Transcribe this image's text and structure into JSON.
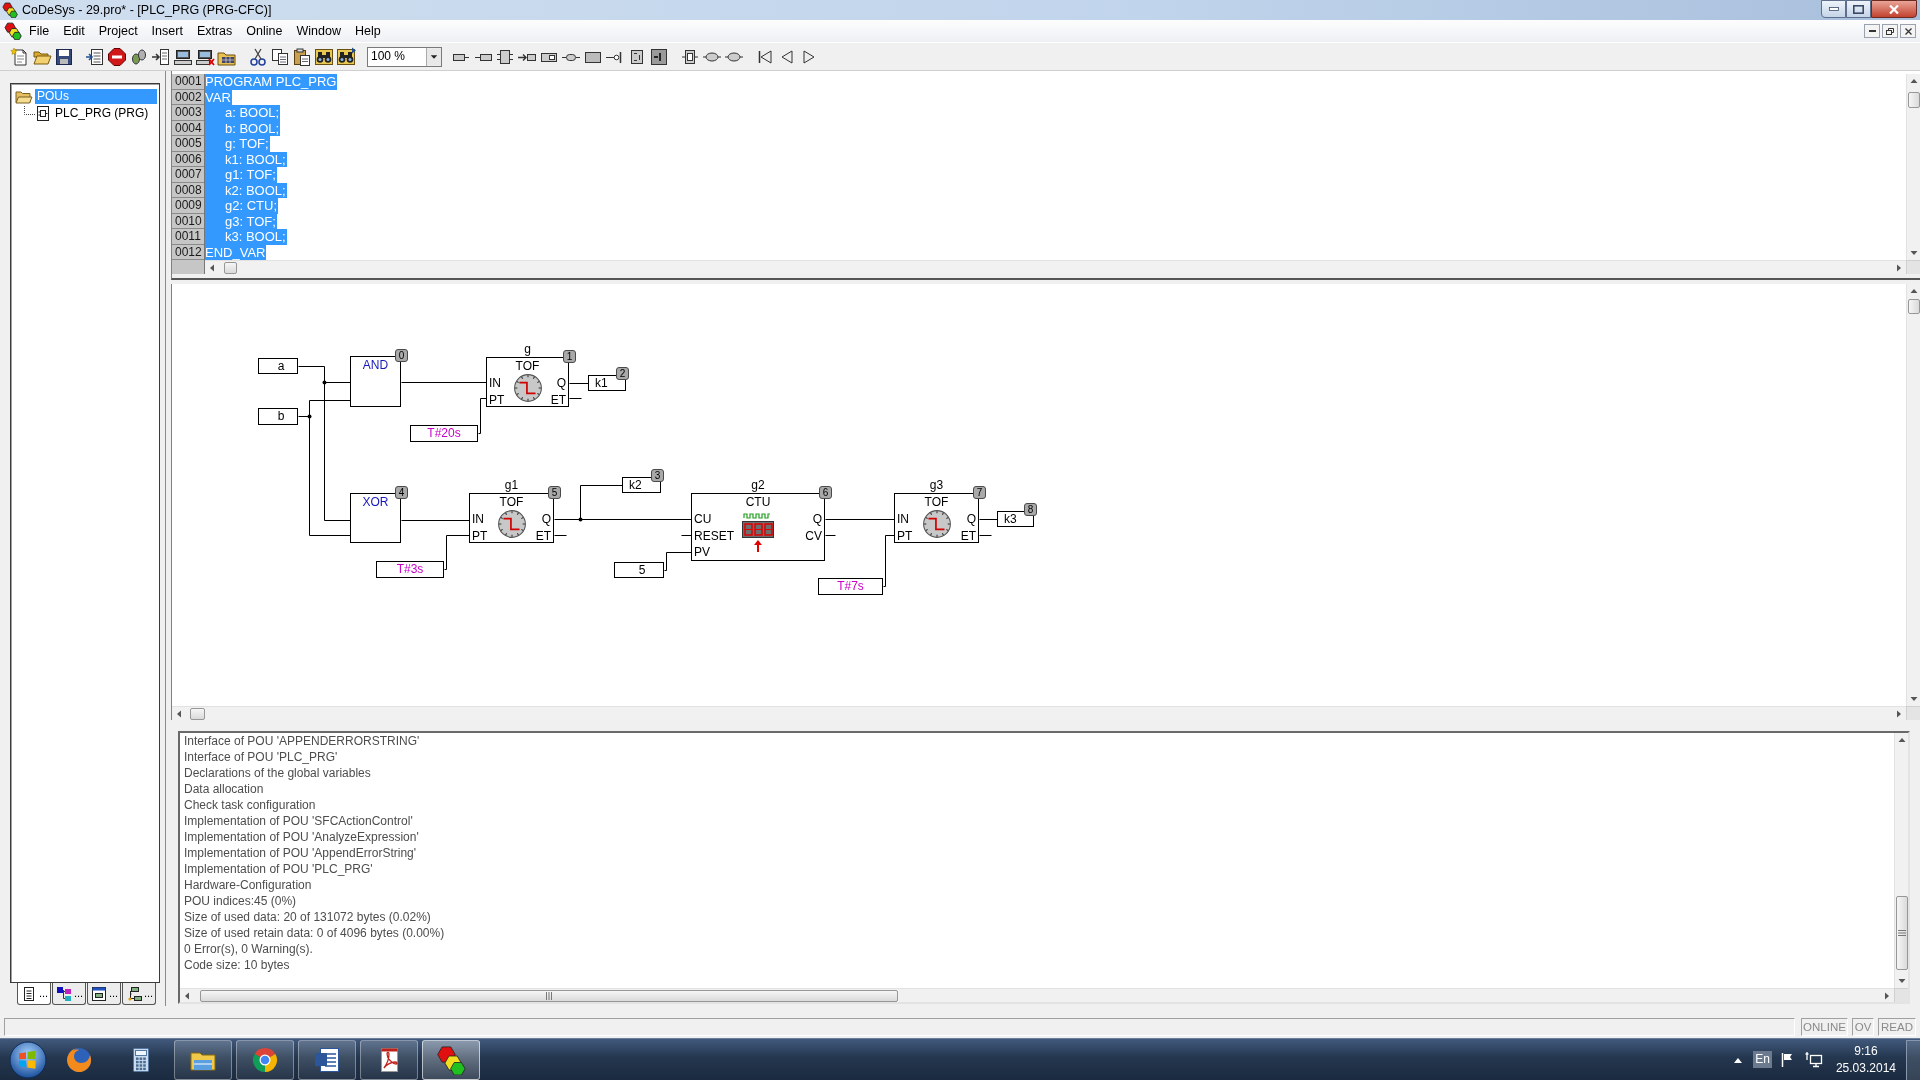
{
  "window": {
    "title": "CoDeSys - 29.pro* - [PLC_PRG (PRG-CFC)]"
  },
  "menu": [
    "File",
    "Edit",
    "Project",
    "Insert",
    "Extras",
    "Online",
    "Window",
    "Help"
  ],
  "toolbar": {
    "zoom": "100 %"
  },
  "project_panel": {
    "tree": [
      {
        "label": "POUs",
        "selected": true,
        "children": [
          {
            "label": "PLC_PRG (PRG)",
            "selected": false
          }
        ]
      }
    ],
    "tabs": [
      {
        "label": "...",
        "selected": true
      },
      {
        "label": "...",
        "selected": false
      },
      {
        "label": "...",
        "selected": false
      },
      {
        "label": "...",
        "selected": false
      }
    ]
  },
  "declaration": {
    "lines": [
      {
        "number": "0001",
        "text": "PROGRAM PLC_PRG",
        "selected": true
      },
      {
        "number": "0002",
        "text": "VAR",
        "selected": true
      },
      {
        "number": "0003",
        "text": "\ta: BOOL;",
        "selected": true
      },
      {
        "number": "0004",
        "text": "\tb: BOOL;",
        "selected": true
      },
      {
        "number": "0005",
        "text": "\tg: TOF;",
        "selected": true
      },
      {
        "number": "0006",
        "text": "\tk1: BOOL;",
        "selected": true
      },
      {
        "number": "0007",
        "text": "\tg1: TOF;",
        "selected": true
      },
      {
        "number": "0008",
        "text": "\tk2: BOOL;",
        "selected": true
      },
      {
        "number": "0009",
        "text": "\tg2: CTU;",
        "selected": true
      },
      {
        "number": "0010",
        "text": "\tg3: TOF;",
        "selected": true
      },
      {
        "number": "0011",
        "text": "\tk3: BOOL;",
        "selected": true
      },
      {
        "number": "0012",
        "text": "END_VAR",
        "selected": true
      }
    ]
  },
  "cfc_diagram": {
    "elements": [
      {
        "kind": "input",
        "text": "a"
      },
      {
        "kind": "operator",
        "type": "AND",
        "order": "0"
      },
      {
        "kind": "timer",
        "instance": "g",
        "type": "TOF",
        "order": "1",
        "inputs": [
          "IN",
          "PT"
        ],
        "outputs": [
          "Q",
          "ET"
        ]
      },
      {
        "kind": "output",
        "text": "k1",
        "order": "2"
      },
      {
        "kind": "input",
        "text": "b"
      },
      {
        "kind": "time_literal",
        "text": "T#20s"
      },
      {
        "kind": "output",
        "text": "k2",
        "order": "3"
      },
      {
        "kind": "operator",
        "type": "XOR",
        "order": "4"
      },
      {
        "kind": "timer",
        "instance": "g1",
        "type": "TOF",
        "order": "5",
        "inputs": [
          "IN",
          "PT"
        ],
        "outputs": [
          "Q",
          "ET"
        ]
      },
      {
        "kind": "counter",
        "instance": "g2",
        "type": "CTU",
        "order": "6",
        "inputs": [
          "CU",
          "RESET",
          "PV"
        ],
        "outputs": [
          "Q",
          "CV"
        ]
      },
      {
        "kind": "timer",
        "instance": "g3",
        "type": "TOF",
        "order": "7",
        "inputs": [
          "IN",
          "PT"
        ],
        "outputs": [
          "Q",
          "ET"
        ]
      },
      {
        "kind": "output",
        "text": "k3",
        "order": "8"
      },
      {
        "kind": "time_literal",
        "text": "T#3s"
      },
      {
        "kind": "input",
        "text": "5"
      },
      {
        "kind": "time_literal",
        "text": "T#7s"
      }
    ]
  },
  "messages": [
    "Interface of POU 'APPENDERRORSTRING'",
    "Interface of POU 'PLC_PRG'",
    "Declarations of the global variables",
    "Data allocation",
    "Check task configuration",
    "Implementation of POU 'SFCActionControl'",
    "Implementation of POU 'AnalyzeExpression'",
    "Implementation of POU 'AppendErrorString'",
    "Implementation of POU 'PLC_PRG'",
    "Hardware-Configuration",
    "POU indices:45 (0%)",
    "Size of used data: 20 of 131072 bytes (0.02%)",
    "Size of used retain data: 0 of 4096 bytes (0.00%)",
    "0 Error(s), 0 Warning(s).",
    "Code size: 10 bytes"
  ],
  "status_bar": {
    "indicators": [
      {
        "label": "ONLINE",
        "active": false
      },
      {
        "label": "OV",
        "active": false
      },
      {
        "label": "READ",
        "active": false
      }
    ]
  },
  "taskbar": {
    "apps": [
      {
        "running": false,
        "selected": false
      },
      {
        "running": false,
        "selected": false
      },
      {
        "running": true,
        "selected": false
      },
      {
        "running": true,
        "selected": false
      },
      {
        "running": true,
        "selected": false
      },
      {
        "running": true,
        "selected": false
      },
      {
        "running": true,
        "selected": true
      }
    ],
    "tray": {
      "language": "En"
    },
    "clock": {
      "time": "9:16",
      "date": "25.03.2014"
    }
  }
}
